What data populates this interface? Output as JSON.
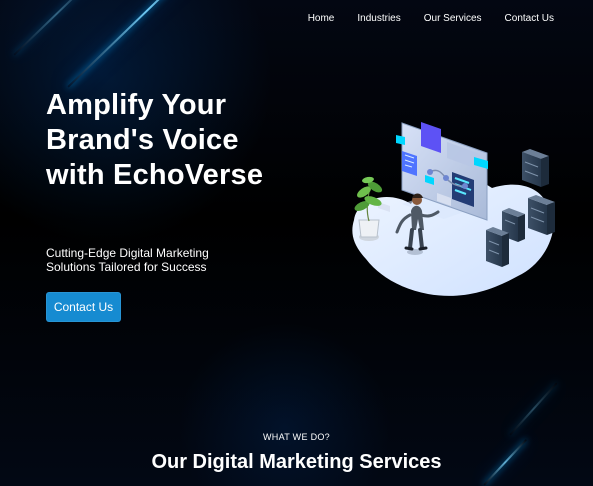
{
  "nav": {
    "items": [
      {
        "label": "Home"
      },
      {
        "label": "Industries"
      },
      {
        "label": "Our Services"
      },
      {
        "label": "Contact Us"
      }
    ]
  },
  "hero": {
    "title": "Amplify Your Brand's Voice with EchoVerse",
    "subtitle": "Cutting-Edge Digital Marketing Solutions Tailored for Success",
    "cta_label": "Contact Us"
  },
  "services": {
    "kicker": "WHAT WE DO?",
    "title": "Our Digital Marketing Services"
  },
  "colors": {
    "background": "#000000",
    "accent_blue": "#168bd1",
    "glow_blue": "#73d2ff"
  },
  "icons": {
    "decorative_illustration": "digital-marketing-illustration-icon"
  }
}
